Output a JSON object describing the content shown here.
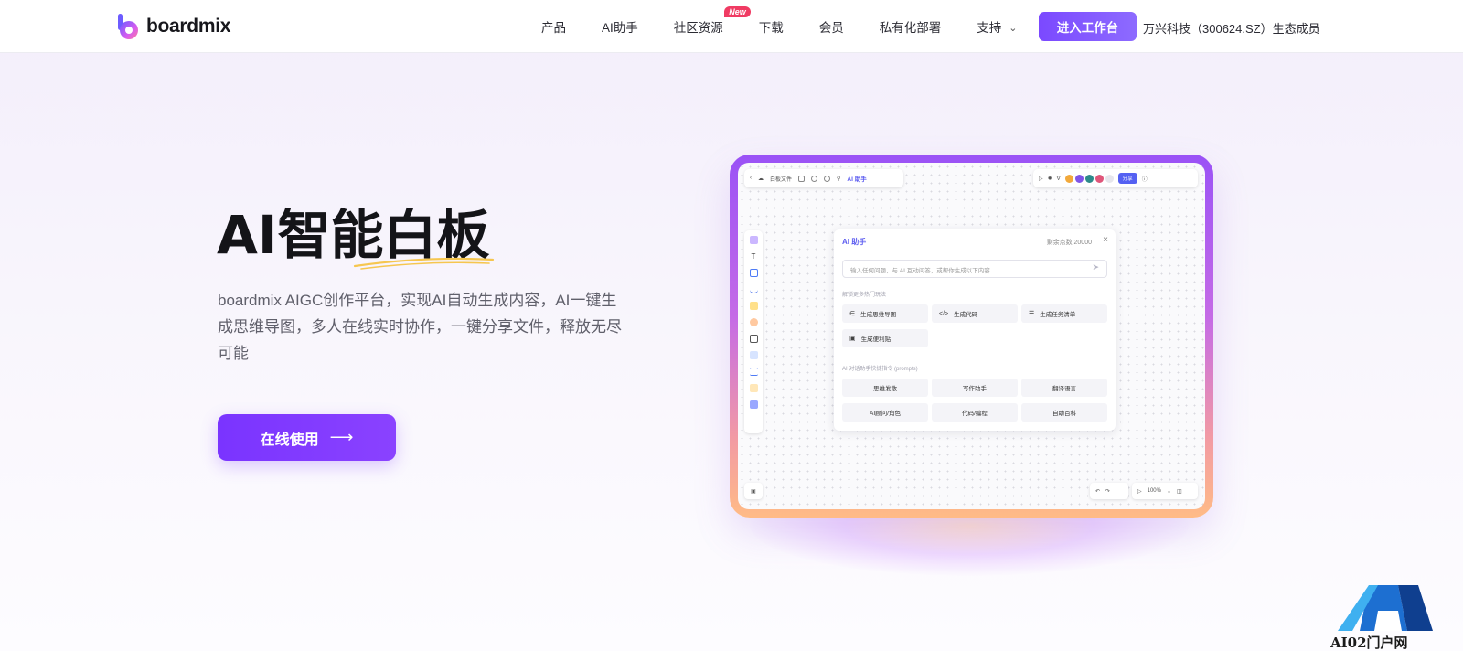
{
  "nav": {
    "brand": "boardmix",
    "items": [
      {
        "label": "产品"
      },
      {
        "label": "AI助手"
      },
      {
        "label": "社区资源",
        "badge": "New"
      },
      {
        "label": "下载"
      },
      {
        "label": "会员"
      },
      {
        "label": "私有化部署"
      },
      {
        "label": "支持",
        "dropdown": true
      }
    ],
    "cta": "进入工作台",
    "ecosystem": "万兴科技（300624.SZ）生态成员"
  },
  "hero": {
    "title": "AI智能白板",
    "subtitle": "boardmix AIGC创作平台，实现AI自动生成内容，AI一键生成思维导图，多人在线实时协作，一键分享文件，释放无尽可能",
    "button": "在线使用",
    "button_icon": "arrow-right-icon"
  },
  "mock": {
    "file_label": "白板文件",
    "ai_tab": "AI 助手",
    "share": "分享",
    "panel_title": "AI 助手",
    "quota": "剩余点数:20000",
    "input_placeholder": "输入任何问题，与 AI 互动问答，或帮你生成以下内容...",
    "section_1": "解锁更多热门玩法",
    "chips_1": [
      "生成思维导图",
      "生成代码",
      "生成任务清单",
      "生成便利贴"
    ],
    "section_2": "AI 对话助手快捷指令 (prompts)",
    "chips_2": [
      "思维发散",
      "写作助手",
      "翻译语言",
      "AI顾问/角色",
      "代码/编程",
      "自助百科"
    ],
    "zoom": "100%"
  },
  "watermark": "AI02门户网",
  "colors": {
    "accent": "#7a34ff",
    "cta": "#8261ff",
    "badge": "#f03b63"
  }
}
